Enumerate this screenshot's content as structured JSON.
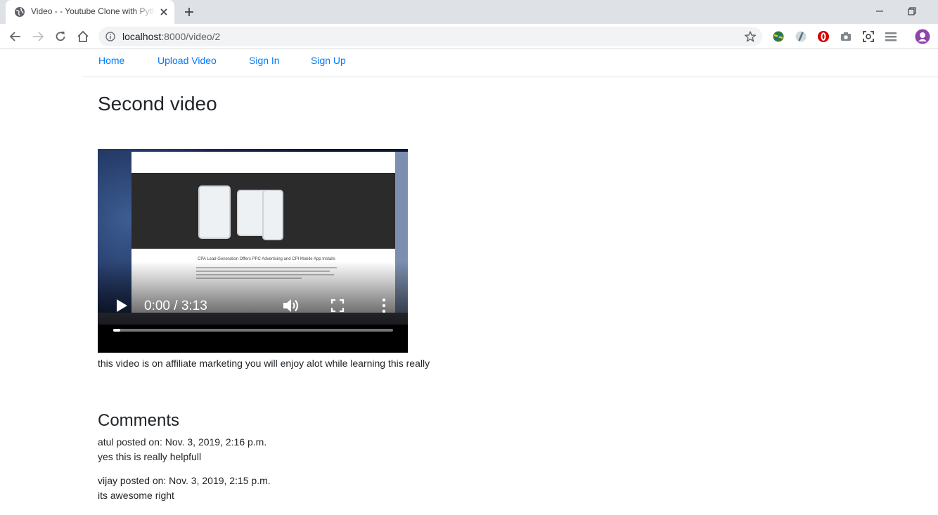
{
  "browser": {
    "tab": {
      "title": "Video - - Youtube Clone with Python Django"
    },
    "address": {
      "host": "localhost",
      "path": ":8000/video/2"
    },
    "colors": {
      "accent": "#1a73e8",
      "chrome_bg": "#dee1e6"
    }
  },
  "site": {
    "nav": [
      {
        "label": "Home"
      },
      {
        "label": "Upload Video"
      },
      {
        "label": "Sign In"
      },
      {
        "label": "Sign Up"
      }
    ],
    "link_color": "#007bff"
  },
  "video": {
    "title": "Second video",
    "description": "this video is on affiliate marketing you will enjoy alot while learning this really",
    "player": {
      "current_time": "0:00",
      "separator": "/",
      "duration": "3:13",
      "progress_fraction": 0.025,
      "poster_headline": "CPA Lead Generation Offers PPC Advertising and CPI Mobile App Installs"
    }
  },
  "comments": {
    "heading": "Comments",
    "items": [
      {
        "header": "atul posted on: Nov. 3, 2019, 2:16 p.m.",
        "body": "yes this is really helpfull"
      },
      {
        "header": "vijay posted on: Nov. 3, 2019, 2:15 p.m.",
        "body": "its awesome right"
      }
    ]
  }
}
